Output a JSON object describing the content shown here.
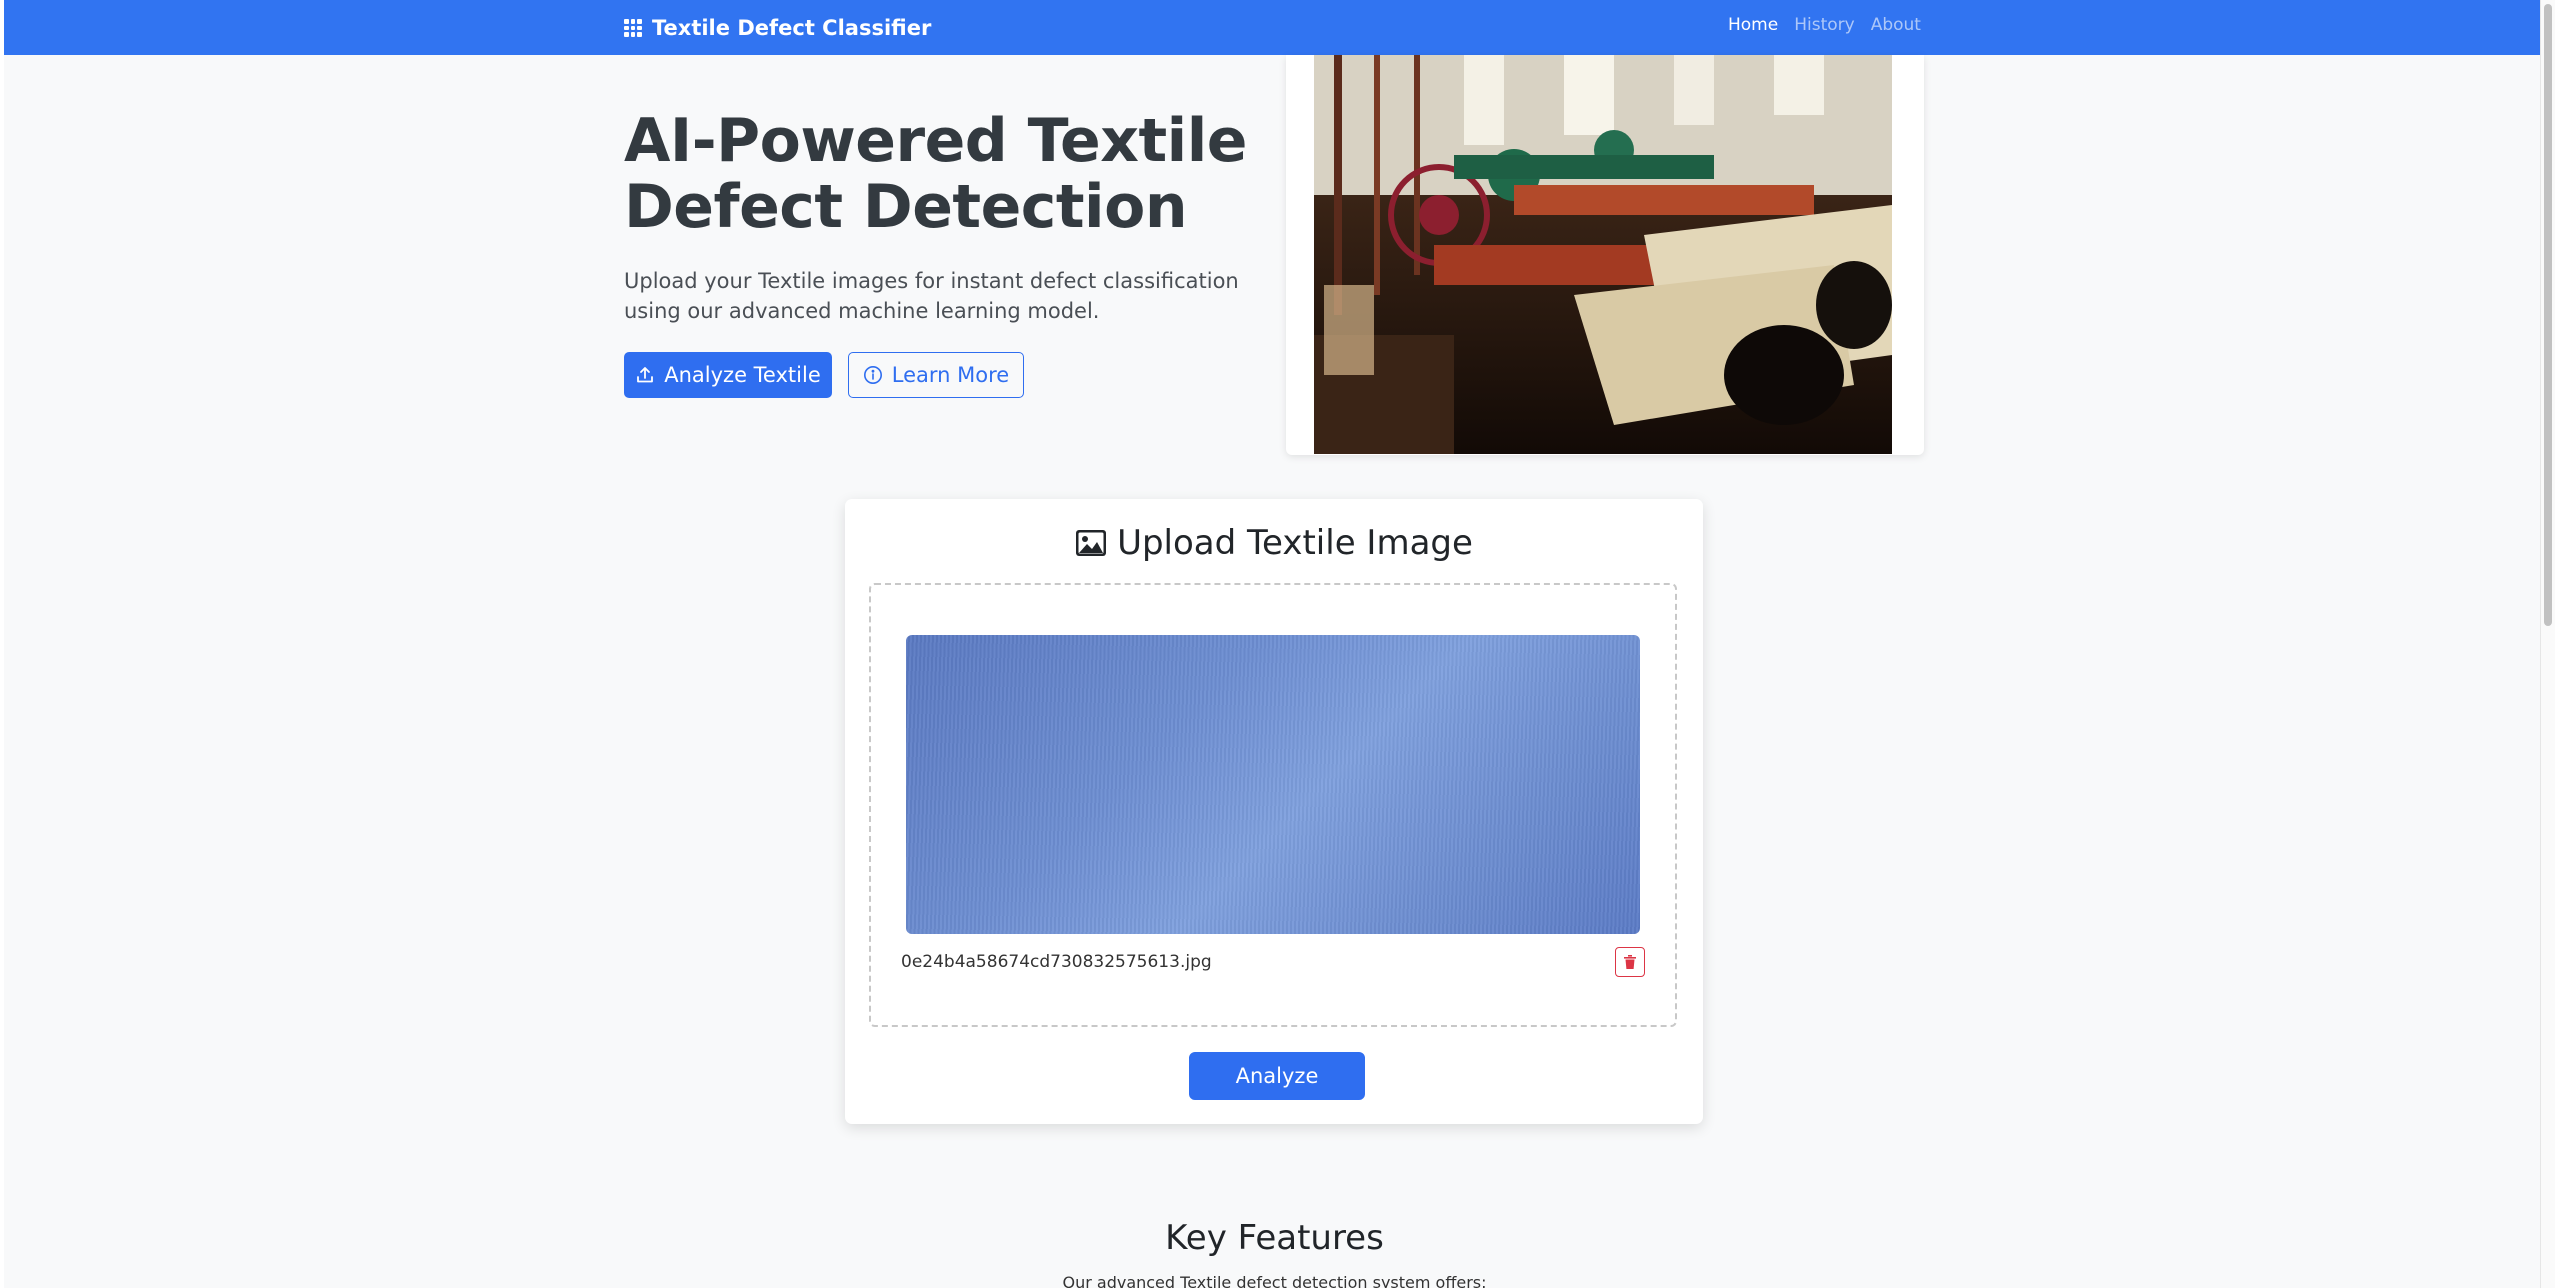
{
  "navbar": {
    "brand": "Textile Defect Classifier",
    "links": [
      {
        "label": "Home",
        "active": true
      },
      {
        "label": "History",
        "active": false
      },
      {
        "label": "About",
        "active": false
      }
    ]
  },
  "hero": {
    "title": "AI-Powered Textile Defect Detection",
    "subtitle": "Upload your Textile images for instant defect classification using our advanced machine learning model.",
    "primary_button": "Analyze Textile",
    "secondary_button": "Learn More"
  },
  "upload": {
    "title": "Upload Textile Image",
    "filename": "0e24b4a58674cd730832575613.jpg",
    "analyze_button": "Analyze"
  },
  "features": {
    "title": "Key Features",
    "subtitle": "Our advanced Textile defect detection system offers:"
  },
  "icons": {
    "brand": "grid-icon",
    "upload_button": "upload-icon",
    "learn_button": "info-circle-icon",
    "upload_title": "image-icon",
    "remove": "trash-icon"
  },
  "colors": {
    "primary": "#3174f1",
    "danger": "#dc3545",
    "background": "#f8f9fa"
  }
}
